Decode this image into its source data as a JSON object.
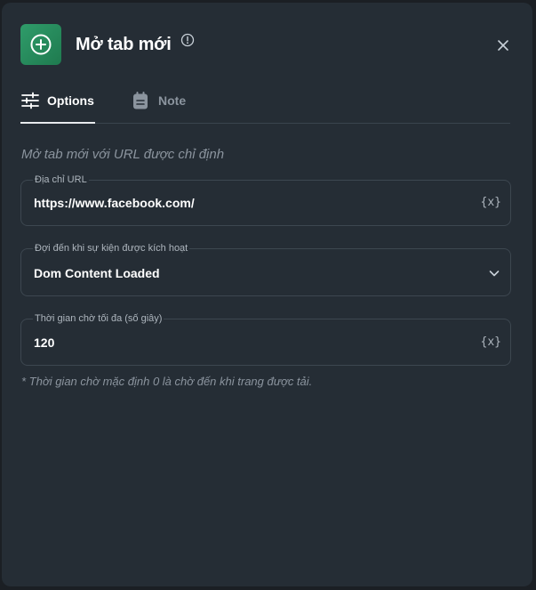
{
  "modal": {
    "title": "Mở tab mới",
    "description": "Mở tab mới với URL được chỉ định",
    "footnote": "* Thời gian chờ mặc định 0 là chờ đến khi trang được tải."
  },
  "tabs": [
    {
      "label": "Options",
      "active": true
    },
    {
      "label": "Note",
      "active": false
    }
  ],
  "fields": {
    "url": {
      "label": "Địa chỉ URL",
      "value": "https://www.facebook.com/",
      "var_button": "{x}"
    },
    "wait_event": {
      "label": "Đợi đến khi sự kiện được kích hoạt",
      "value": "Dom Content Loaded"
    },
    "timeout": {
      "label": "Thời gian chờ tối đa (số giây)",
      "value": "120",
      "var_button": "{x}"
    }
  },
  "colors": {
    "accent": "#2f9c6a",
    "background": "#252d35",
    "text": "#ffffff",
    "muted": "#8b949e"
  },
  "icons": {
    "app": "plus-circle-icon",
    "info": "info-icon",
    "close": "close-icon",
    "options": "sliders-icon",
    "note": "notepad-icon",
    "dropdown": "chevron-down-icon"
  }
}
